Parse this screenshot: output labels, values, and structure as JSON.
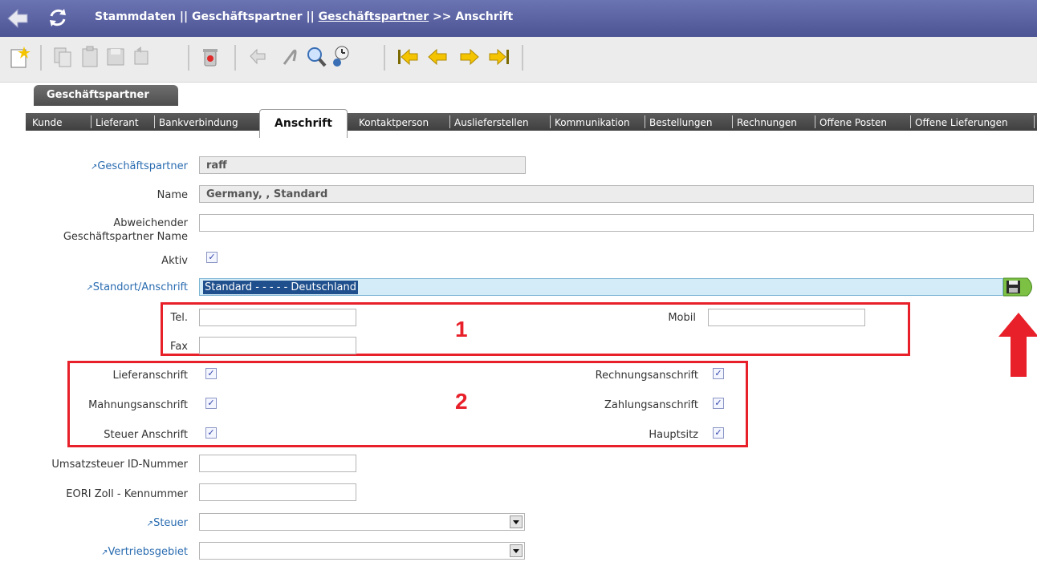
{
  "header": {
    "crumb_part1": "Stammdaten || Geschäftspartner || ",
    "crumb_link": "Geschäftspartner",
    "crumb_part2": " >> Anschrift"
  },
  "toolbar": {
    "icons": [
      "new-icon",
      "copy-icon",
      "paste-icon",
      "save-icon",
      "undo-icon",
      "delete-icon",
      "history-icon",
      "attach-icon",
      "find-icon",
      "zoom-icon",
      "first-icon",
      "prev-icon",
      "next-icon",
      "last-icon"
    ]
  },
  "tabs": {
    "group_label": "Geschäftspartner",
    "items": [
      "Kunde",
      "Lieferant",
      "Bankverbindung",
      "Anschrift",
      "Kontaktperson",
      "Auslieferstellen",
      "Kommunikation",
      "Bestellungen",
      "Rechnungen",
      "Offene Posten",
      "Offene Lieferungen"
    ]
  },
  "form": {
    "geschaeftspartner_label": "Geschäftspartner",
    "geschaeftspartner_value": "raff",
    "name_label": "Name",
    "name_value": "Germany, , Standard",
    "abweichender_label": "Abweichender Geschäftspartner Name",
    "abweichender_value": "",
    "aktiv_label": "Aktiv",
    "aktiv_checked": true,
    "standort_label": "Standort/Anschrift",
    "standort_value": "Standard - - - - - Deutschland",
    "tel_label": "Tel.",
    "fax_label": "Fax",
    "mobil_label": "Mobil",
    "lieferanschrift_label": "Lieferanschrift",
    "mahnungsanschrift_label": "Mahnungsanschrift",
    "steuer_anschrift_label": "Steuer Anschrift",
    "rechnungsanschrift_label": "Rechnungsanschrift",
    "zahlungsanschrift_label": "Zahlungsanschrift",
    "hauptsitz_label": "Hauptsitz",
    "ust_label": "Umsatzsteuer ID-Nummer",
    "eori_label": "EORI Zoll - Kennummer",
    "steuer_label": "Steuer",
    "vertriebsgebiet_label": "Vertriebsgebiet"
  },
  "annotations": {
    "box1_number": "1",
    "box2_number": "2"
  },
  "colors": {
    "highlight_red": "#e8202a",
    "link_blue": "#2a6cb0",
    "header_bg": "#5a61a0"
  }
}
